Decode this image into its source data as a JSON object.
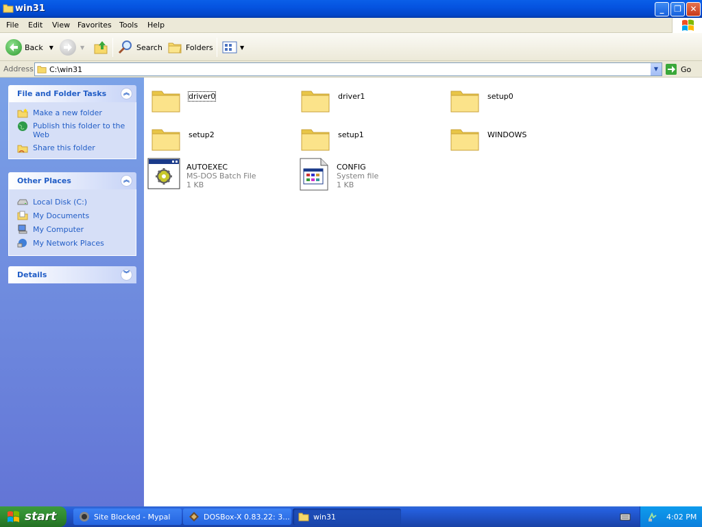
{
  "window": {
    "title": "win31"
  },
  "menu": [
    "File",
    "Edit",
    "View",
    "Favorites",
    "Tools",
    "Help"
  ],
  "toolbar": {
    "back": "Back",
    "search": "Search",
    "folders": "Folders"
  },
  "address": {
    "label": "Address",
    "value": "C:\\win31",
    "go": "Go"
  },
  "sidebar": {
    "tasks": {
      "title": "File and Folder Tasks",
      "items": [
        "Make a new folder",
        "Publish this folder to the Web",
        "Share this folder"
      ]
    },
    "places": {
      "title": "Other Places",
      "items": [
        "Local Disk (C:)",
        "My Documents",
        "My Computer",
        "My Network Places"
      ]
    },
    "details": {
      "title": "Details"
    }
  },
  "items": [
    {
      "name": "driver0",
      "kind": "folder",
      "selected": true
    },
    {
      "name": "driver1",
      "kind": "folder"
    },
    {
      "name": "setup0",
      "kind": "folder"
    },
    {
      "name": "setup2",
      "kind": "folder"
    },
    {
      "name": "setup1",
      "kind": "folder"
    },
    {
      "name": "WINDOWS",
      "kind": "folder"
    },
    {
      "name": "AUTOEXEC",
      "kind": "file",
      "type": "MS-DOS Batch File",
      "size": "1 KB"
    },
    {
      "name": "CONFIG",
      "kind": "file",
      "type": "System file",
      "size": "1 KB"
    }
  ],
  "taskbar": {
    "start": "start",
    "tasks": [
      "Site Blocked - Mypal",
      "DOSBox-X 0.83.22: 3...",
      "win31"
    ],
    "clock": "4:02 PM"
  },
  "colors": {
    "titlebar": "#0553e0",
    "sidebar": "#7ba2e7",
    "sidebar_link": "#215dc6",
    "start": "#2f8a2f",
    "taskbar": "#245edb"
  }
}
